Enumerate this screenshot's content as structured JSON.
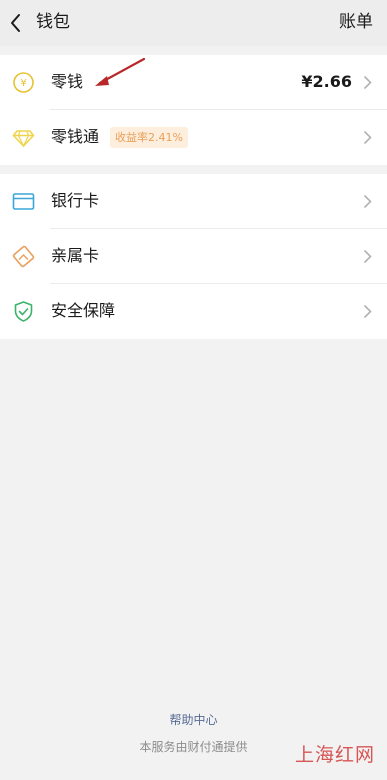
{
  "header": {
    "title": "钱包",
    "bill_label": "账单"
  },
  "wallet": {
    "items": [
      {
        "label": "零钱",
        "amount": "¥2.66",
        "icon": "coin-yen-icon"
      },
      {
        "label": "零钱通",
        "badge": "收益率2.41%",
        "icon": "diamond-icon"
      }
    ]
  },
  "cards": {
    "items": [
      {
        "label": "银行卡",
        "icon": "bank-card-icon"
      },
      {
        "label": "亲属卡",
        "icon": "family-card-icon"
      },
      {
        "label": "安全保障",
        "icon": "shield-check-icon"
      }
    ]
  },
  "footer": {
    "help_label": "帮助中心",
    "service_note": "本服务由财付通提供"
  },
  "watermark": "上海红网",
  "colors": {
    "background": "#f2f2f2",
    "link": "#576b95",
    "coin": "#e6c233",
    "diamond": "#f0d44a",
    "bank_card": "#3aa7d8",
    "family_card": "#e8a05a",
    "shield": "#3bb36b",
    "badge_bg": "#fdeedd",
    "badge_text": "#e8a05a",
    "annotation_arrow": "#b8282a"
  }
}
